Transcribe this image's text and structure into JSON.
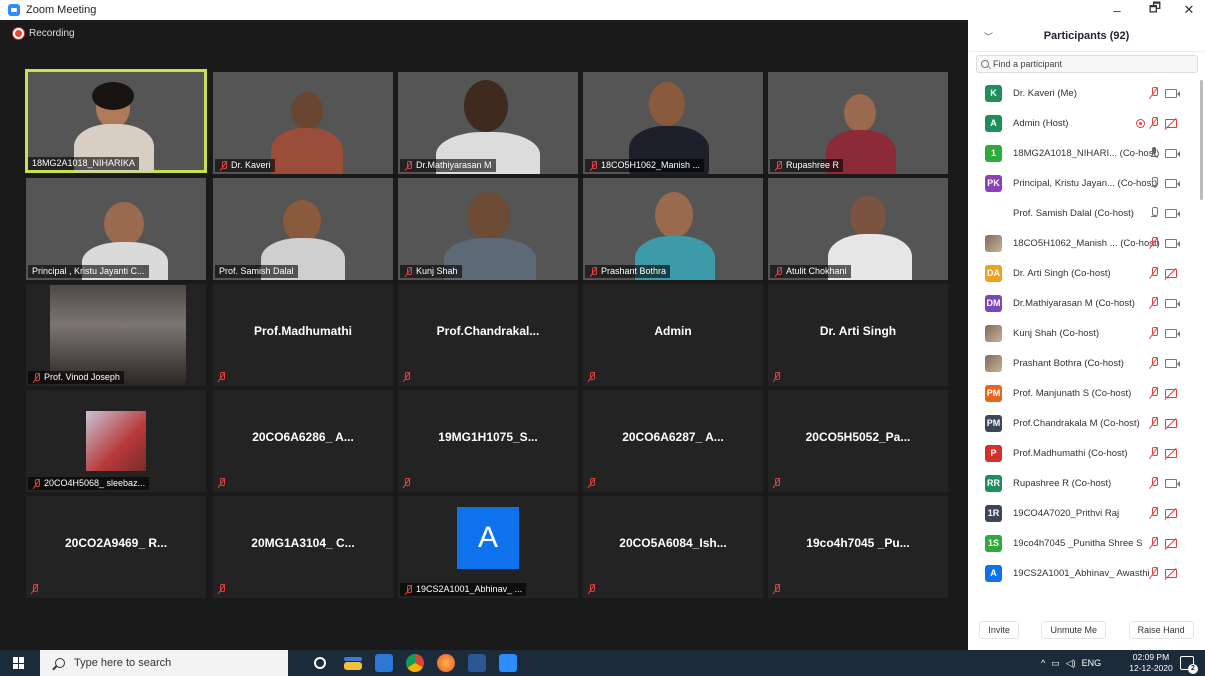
{
  "window": {
    "title": "Zoom Meeting",
    "minimize": "–",
    "maximize": "🗗",
    "close": "✕"
  },
  "recording": {
    "label": "Recording"
  },
  "tiles": [
    {
      "label": "18MG2A1018_NIHARIKA",
      "muted": false
    },
    {
      "label": "Dr. Kaveri",
      "muted": true
    },
    {
      "label": "Dr.Mathiyarasan M",
      "muted": true
    },
    {
      "label": "18CO5H1062_Manish ...",
      "muted": true
    },
    {
      "label": "Rupashree R",
      "muted": true
    },
    {
      "label": "Principal , Kristu Jayanti C...",
      "muted": false
    },
    {
      "label": "Prof. Samish Dalal",
      "muted": false
    },
    {
      "label": "Kunj Shah",
      "muted": true
    },
    {
      "label": "Prashant Bothra",
      "muted": true
    },
    {
      "label": "Atulit Chokhani",
      "muted": true
    },
    {
      "label": "Prof. Vinod Joseph",
      "muted": true
    },
    {
      "center": "Prof.Madhumathi"
    },
    {
      "center": "Prof.Chandrakal..."
    },
    {
      "center": "Admin"
    },
    {
      "center": "Dr. Arti Singh"
    },
    {
      "label": "20CO4H5068_ sleebaz...",
      "muted": true
    },
    {
      "center": "20CO6A6286_ A..."
    },
    {
      "center": "19MG1H1075_S..."
    },
    {
      "center": "20CO6A6287_ A..."
    },
    {
      "center": "20CO5H5052_Pa..."
    },
    {
      "center": "20CO2A9469_ R..."
    },
    {
      "center": "20MG1A3104_ C..."
    },
    {
      "label": "19CS2A1001_Abhinav_ ...",
      "muted": true,
      "avatar": "A"
    },
    {
      "center": "20CO5A6084_Ish..."
    },
    {
      "center": "19co4h7045 _Pu..."
    }
  ],
  "panel": {
    "title": "Participants (92)",
    "search_placeholder": "Find a participant",
    "participants": [
      {
        "initials": "K",
        "color": "#1e8f5b",
        "name": "Dr. Kaveri (Me)",
        "mic": "muted",
        "cam": "on"
      },
      {
        "initials": "A",
        "color": "#1e8f5b",
        "name": "Admin (Host)",
        "mic": "muted",
        "cam": "off",
        "rec": true
      },
      {
        "initials": "1",
        "color": "#2eaa3a",
        "name": "18MG2A1018_NIHARI... (Co-host)",
        "mic": "active",
        "cam": "on"
      },
      {
        "initials": "PK",
        "color": "#8e3fb5",
        "name": "Principal, Kristu Jayan... (Co-host)",
        "mic": "on",
        "cam": "on"
      },
      {
        "initials": "",
        "color": "",
        "name": "Prof. Samish Dalal (Co-host)",
        "mic": "on",
        "cam": "on"
      },
      {
        "initials": "",
        "color": "photo",
        "name": "18CO5H1062_Manish ... (Co-host)",
        "mic": "muted",
        "cam": "on"
      },
      {
        "initials": "DA",
        "color": "#f0a020",
        "name": "Dr. Arti Singh (Co-host)",
        "mic": "muted",
        "cam": "off"
      },
      {
        "initials": "DM",
        "color": "#7a46b8",
        "name": "Dr.Mathiyarasan M (Co-host)",
        "mic": "muted",
        "cam": "on"
      },
      {
        "initials": "",
        "color": "photo",
        "name": "Kunj Shah (Co-host)",
        "mic": "muted",
        "cam": "on"
      },
      {
        "initials": "",
        "color": "photo",
        "name": "Prashant Bothra (Co-host)",
        "mic": "muted",
        "cam": "on"
      },
      {
        "initials": "PM",
        "color": "#e8651e",
        "name": "Prof. Manjunath S (Co-host)",
        "mic": "muted",
        "cam": "off"
      },
      {
        "initials": "PM",
        "color": "#3b4756",
        "name": "Prof.Chandrakala M (Co-host)",
        "mic": "muted",
        "cam": "off"
      },
      {
        "initials": "P",
        "color": "#d3312b",
        "name": "Prof.Madhumathi (Co-host)",
        "mic": "muted",
        "cam": "off"
      },
      {
        "initials": "RR",
        "color": "#1e8f5b",
        "name": "Rupashree R (Co-host)",
        "mic": "muted",
        "cam": "on"
      },
      {
        "initials": "1R",
        "color": "#3b4756",
        "name": "19CO4A7020_Prithvi Raj",
        "mic": "muted",
        "cam": "off"
      },
      {
        "initials": "1S",
        "color": "#2eaa3a",
        "name": "19co4h7045 _Punitha Shree S",
        "mic": "muted",
        "cam": "off"
      },
      {
        "initials": "A",
        "color": "#0e72ed",
        "name": "19CS2A1001_Abhinav_ Awasthi",
        "mic": "muted",
        "cam": "off"
      }
    ],
    "buttons": {
      "invite": "Invite",
      "unmute": "Unmute Me",
      "raise": "Raise Hand"
    }
  },
  "taskbar": {
    "search_placeholder": "Type here to search",
    "tray_lang": "ENG",
    "time": "02:09 PM",
    "date": "12-12-2020",
    "notifications": "2"
  }
}
